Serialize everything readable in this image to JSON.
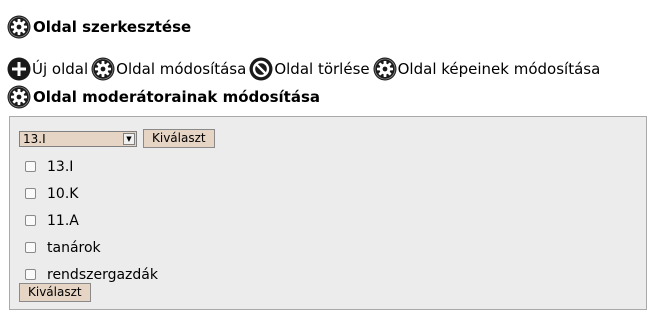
{
  "header": {
    "title": "Oldal szerkesztése",
    "icon": "gear-icon"
  },
  "actions": [
    {
      "label": "Új oldal",
      "icon": "plus-circle-icon"
    },
    {
      "label": "Oldal módosítása",
      "icon": "gear-icon"
    },
    {
      "label": "Oldal törlése",
      "icon": "no-entry-icon"
    },
    {
      "label": "Oldal képeinek módosítása",
      "icon": "gear-icon"
    }
  ],
  "moderators": {
    "title": "Oldal moderátorainak módosítása",
    "icon": "gear-icon",
    "select_value": "13.I",
    "select_button": "Kiválaszt",
    "checkboxes": [
      {
        "label": "13.I",
        "checked": false
      },
      {
        "label": "10.K",
        "checked": false
      },
      {
        "label": "11.A",
        "checked": false
      },
      {
        "label": "tanárok",
        "checked": false
      },
      {
        "label": "rendszergazdák",
        "checked": false
      }
    ],
    "submit_button": "Kiválaszt"
  },
  "colors": {
    "icon_dark": "#1a1a1a",
    "button_bg": "#e6d4c4",
    "panel_bg": "#ececec"
  }
}
